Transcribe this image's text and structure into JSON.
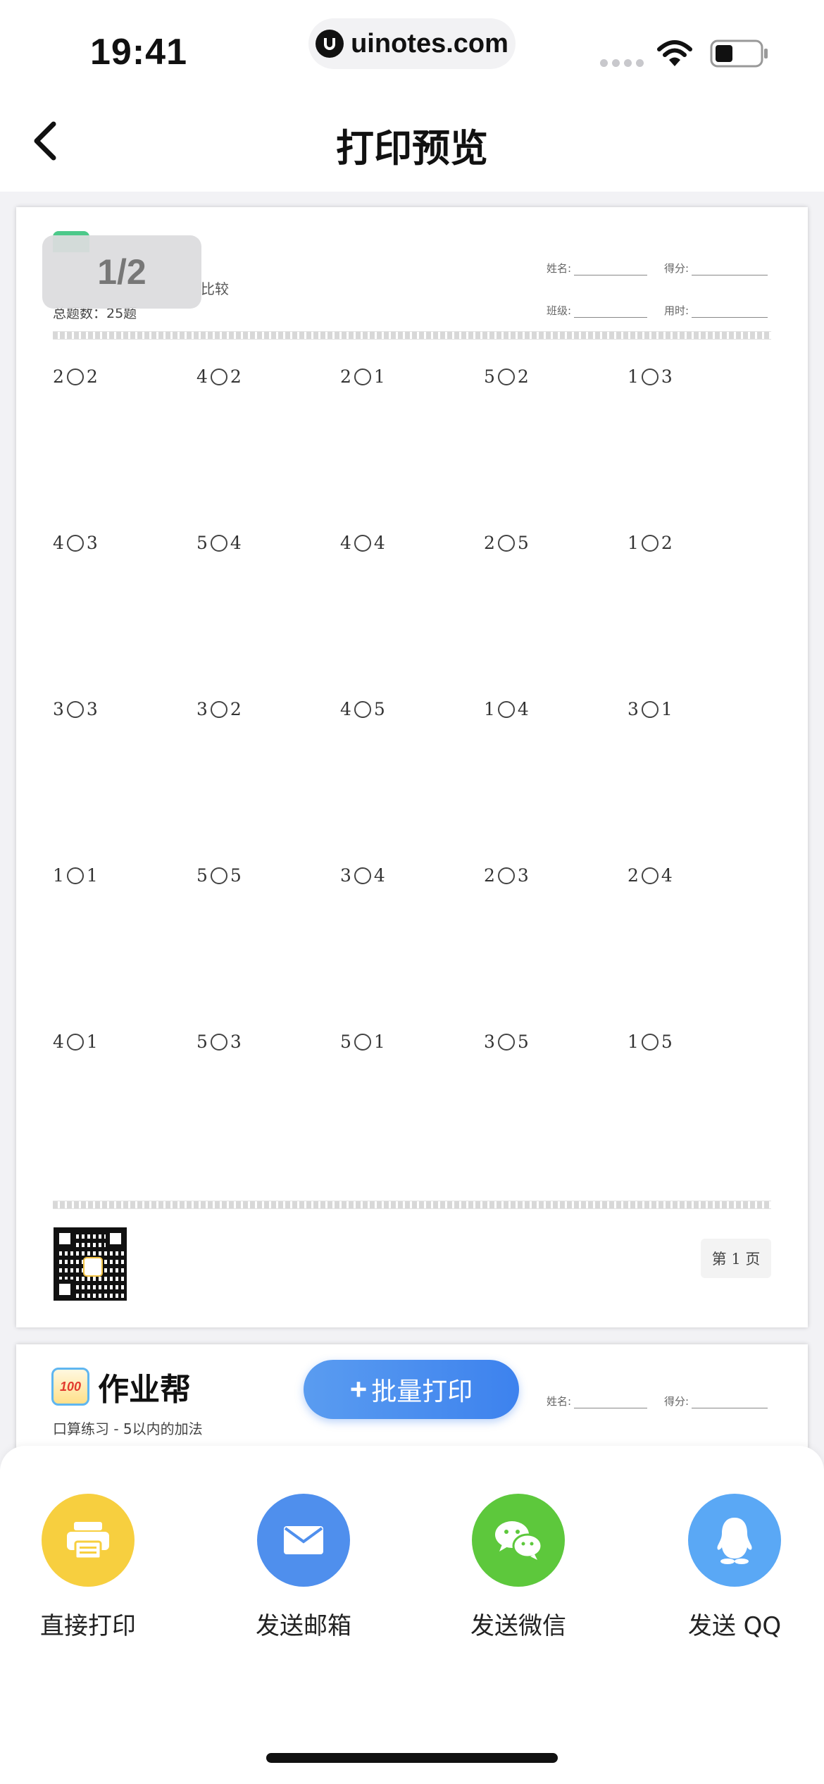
{
  "status_bar": {
    "time": "19:41",
    "url": "uinotes.com",
    "icons": [
      "signal-icon",
      "wifi-icon",
      "battery-icon"
    ]
  },
  "nav": {
    "title": "打印预览",
    "back_icon": "chevron-left-icon"
  },
  "preview": {
    "page_indicator": "1/2",
    "sheet1": {
      "subtitle_fragment": "比较",
      "count": "总题数：25题",
      "fields": {
        "name": "姓名:",
        "score": "得分:",
        "class": "班级:",
        "time": "用时:"
      },
      "rows": [
        [
          "2",
          "2",
          "4",
          "2",
          "2",
          "1",
          "5",
          "2",
          "1",
          "3"
        ],
        [
          "4",
          "3",
          "5",
          "4",
          "4",
          "4",
          "2",
          "5",
          "1",
          "2"
        ],
        [
          "3",
          "3",
          "3",
          "2",
          "4",
          "5",
          "1",
          "4",
          "3",
          "1"
        ],
        [
          "1",
          "1",
          "5",
          "5",
          "3",
          "4",
          "2",
          "3",
          "2",
          "4"
        ],
        [
          "4",
          "1",
          "5",
          "3",
          "5",
          "1",
          "3",
          "5",
          "1",
          "5"
        ]
      ],
      "problems": [
        {
          "a": "2",
          "b": "2"
        },
        {
          "a": "4",
          "b": "2"
        },
        {
          "a": "2",
          "b": "1"
        },
        {
          "a": "5",
          "b": "2"
        },
        {
          "a": "1",
          "b": "3"
        },
        {
          "a": "4",
          "b": "3"
        },
        {
          "a": "5",
          "b": "4"
        },
        {
          "a": "4",
          "b": "4"
        },
        {
          "a": "2",
          "b": "5"
        },
        {
          "a": "1",
          "b": "2"
        },
        {
          "a": "3",
          "b": "3"
        },
        {
          "a": "3",
          "b": "2"
        },
        {
          "a": "4",
          "b": "5"
        },
        {
          "a": "1",
          "b": "4"
        },
        {
          "a": "3",
          "b": "1"
        },
        {
          "a": "1",
          "b": "1"
        },
        {
          "a": "5",
          "b": "5"
        },
        {
          "a": "3",
          "b": "4"
        },
        {
          "a": "2",
          "b": "3"
        },
        {
          "a": "2",
          "b": "4"
        },
        {
          "a": "4",
          "b": "1"
        },
        {
          "a": "5",
          "b": "3"
        },
        {
          "a": "5",
          "b": "1"
        },
        {
          "a": "3",
          "b": "5"
        },
        {
          "a": "1",
          "b": "5"
        }
      ],
      "page_label": "第 1 页"
    },
    "sheet2": {
      "brand_logo": "100",
      "brand_name": "作业帮",
      "subtitle": "口算练习 - 5以内的加法",
      "fields": {
        "name": "姓名:",
        "score": "得分:"
      }
    }
  },
  "batch_print": {
    "label": "批量打印"
  },
  "share": {
    "items": [
      {
        "label": "直接打印",
        "icon": "printer-icon",
        "color": "#f7cf3f"
      },
      {
        "label": "发送邮箱",
        "icon": "mail-icon",
        "color": "#4f8fed"
      },
      {
        "label": "发送微信",
        "icon": "wechat-icon",
        "color": "#5dc83c"
      },
      {
        "label": "发送 QQ",
        "icon": "qq-icon",
        "color": "#5aa8f5"
      }
    ]
  }
}
